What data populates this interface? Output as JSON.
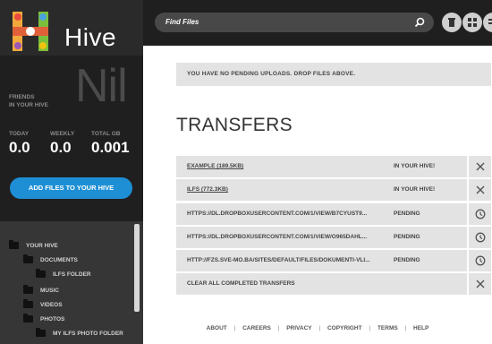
{
  "app": {
    "name": "Hive"
  },
  "sidebar": {
    "friends_label_1": "FRIENDS",
    "friends_label_2": "IN YOUR HIVE",
    "friends_count": "Nil",
    "stats": [
      {
        "label": "TODAY",
        "value": "0.0"
      },
      {
        "label": "WEEKLY",
        "value": "0.0"
      },
      {
        "label": "TOTAL GB",
        "value": "0.001"
      }
    ],
    "add_button": "ADD FILES TO YOUR HIVE",
    "tree": [
      {
        "label": "YOUR HIVE"
      },
      {
        "label": "DOCUMENTS"
      },
      {
        "label": "ILFS FOLDER"
      },
      {
        "label": "MUSIC"
      },
      {
        "label": "VIDEOS"
      },
      {
        "label": "PHOTOS"
      },
      {
        "label": "MY ILFS PHOTO FOLDER"
      }
    ]
  },
  "search": {
    "placeholder": "Find Files"
  },
  "main": {
    "pending_message": "YOU HAVE NO PENDING UPLOADS. DROP FILES ABOVE.",
    "transfers_title": "TRANSFERS",
    "transfers": [
      {
        "name": "EXAMPLE (189.5KB)",
        "status": "IN YOUR HIVE!",
        "action": "close-icon"
      },
      {
        "name": "ILFS (772.3KB)",
        "status": "IN YOUR HIVE!",
        "action": "close-icon"
      },
      {
        "name": "HTTPS://DL.DROPBOXUSERCONTENT.COM/1/VIEW/B7CYUST9...",
        "status": "PENDING",
        "action": "clock-icon"
      },
      {
        "name": "HTTPS://DL.DROPBOXUSERCONTENT.COM/1/VIEW/O965DAHL...",
        "status": "PENDING",
        "action": "clock-icon"
      },
      {
        "name": "HTTP://FZS.SVE-MO.BA/SITES/DEFAULT/FILES/DOKUMENTI-VLI...",
        "status": "PENDING",
        "action": "clock-icon"
      },
      {
        "name": "CLEAR ALL COMPLETED TRANSFERS",
        "status": "",
        "action": "close-icon"
      }
    ]
  },
  "footer": {
    "links": [
      "ABOUT",
      "CAREERS",
      "PRIVACY",
      "COPYRIGHT",
      "TERMS",
      "HELP"
    ],
    "separator": "|"
  },
  "colors": {
    "sidebar_bg": "#1f1f1f",
    "accent_blue": "#1e8fd4",
    "row_bg": "#e3e3e3"
  }
}
